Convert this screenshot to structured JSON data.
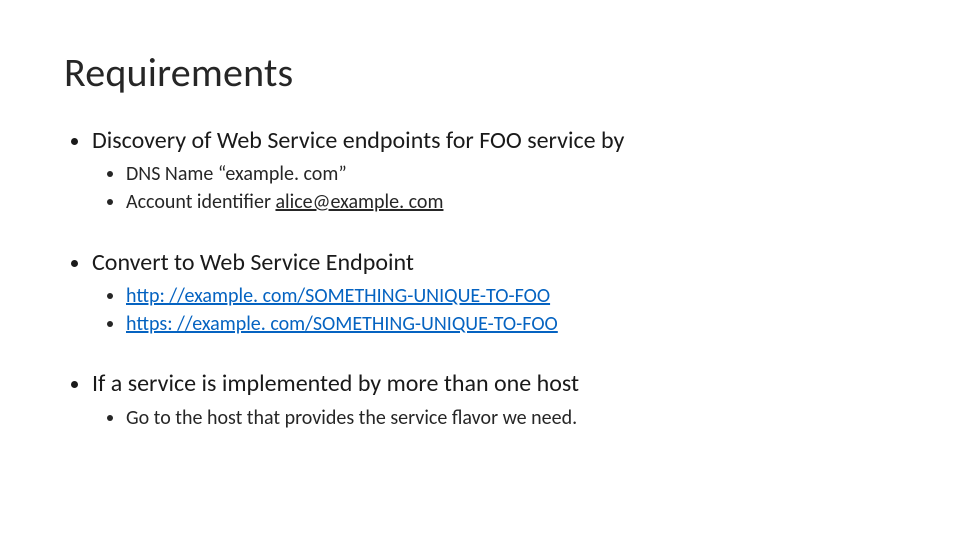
{
  "title": "Requirements",
  "b1": {
    "text": "Discovery of Web Service endpoints for FOO service by",
    "sub": {
      "a_pre": "DNS Name “example. com”",
      "b_pre": "Account identifier ",
      "b_link": "alice@example. com"
    }
  },
  "b2": {
    "text": "Convert to Web Service Endpoint",
    "sub": {
      "a_link": "http: //example. com/SOMETHING-UNIQUE-TO-FOO",
      "b_link": "https: //example. com/SOMETHING-UNIQUE-TO-FOO"
    }
  },
  "b3": {
    "text": "If a service is implemented by more than one host",
    "sub": {
      "a": "Go to the host that provides the service flavor we need."
    }
  }
}
